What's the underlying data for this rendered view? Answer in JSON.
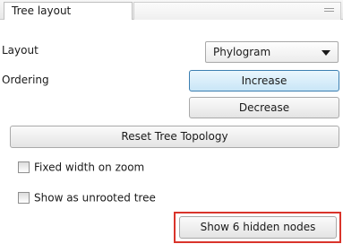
{
  "panel": {
    "tab_title": "Tree layout"
  },
  "layout": {
    "label": "Layout",
    "selected": "Phylogram"
  },
  "ordering": {
    "label": "Ordering",
    "increase_label": "Increase",
    "decrease_label": "Decrease"
  },
  "reset_label": "Reset Tree Topology",
  "options": {
    "fixed_width_label": "Fixed width on zoom",
    "fixed_width_checked": false,
    "unrooted_label": "Show as unrooted tree",
    "unrooted_checked": false
  },
  "show_hidden_label": "Show 6 hidden nodes",
  "colors": {
    "highlight": "#d9342b",
    "active_button_border": "#3c7fb1",
    "active_button_fill": "#c9e6f7"
  }
}
